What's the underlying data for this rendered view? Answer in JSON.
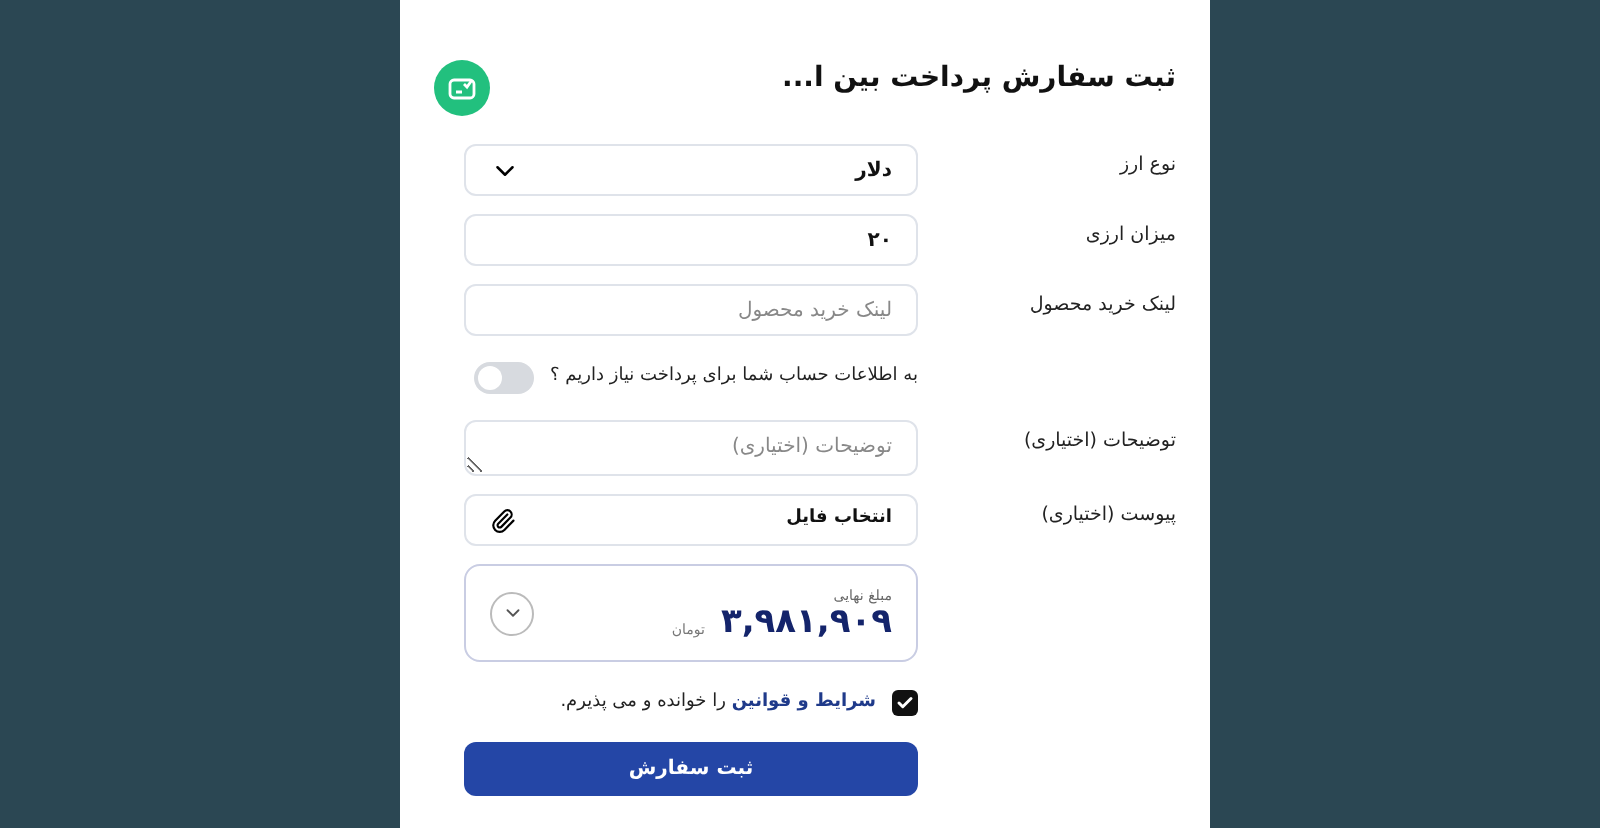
{
  "title": "ثبت سفارش پرداخت بین ا...",
  "fields": [
    {
      "kind": "select",
      "label": "نوع ارز",
      "value": "دلار"
    },
    {
      "kind": "text",
      "label": "میزان ارزی",
      "value": "۲۰"
    },
    {
      "kind": "text",
      "label": "لینک خرید محصول",
      "placeholder": "لینک خرید محصول"
    },
    {
      "kind": "toggle",
      "label": "به اطلاعات حساب شما برای پرداخت نیاز داریم ؟",
      "on": false
    },
    {
      "kind": "textarea",
      "label": "توضیحات (اختیاری)",
      "placeholder": "توضیحات (اختیاری)"
    },
    {
      "kind": "file",
      "label": "پیوست (اختیاری)",
      "value": "انتخاب فایل"
    }
  ],
  "total": {
    "label": "مبلغ نهایی",
    "amount": "۳,۹۸۱,۹۰۹",
    "unit": "تومان"
  },
  "terms": {
    "checked": true,
    "link": "شرایط و قوانین",
    "text": "را خوانده و می پذیرم."
  },
  "submit": "ثبت سفارش"
}
